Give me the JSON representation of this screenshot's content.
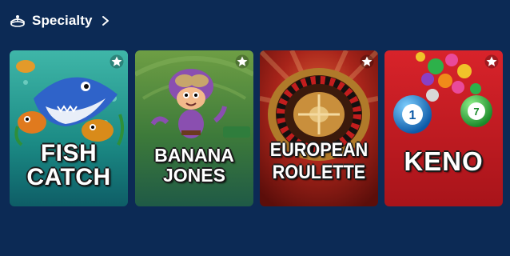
{
  "section": {
    "title": "Specialty",
    "icon": "carousel-icon",
    "link_icon": "chevron-right-icon"
  },
  "games": [
    {
      "line1": "FISH",
      "line2": "CATCH",
      "favorite_icon": "star-icon"
    },
    {
      "line1": "BANANA",
      "line2": "JONES",
      "favorite_icon": "star-icon"
    },
    {
      "line1": "EUROPEAN",
      "line2": "ROULETTE",
      "favorite_icon": "star-icon"
    },
    {
      "line1": "KENO",
      "line2": "",
      "favorite_icon": "star-icon"
    }
  ],
  "colors": {
    "page_background": "#0c2a55",
    "text": "#ffffff",
    "fish_bg": "#1d8a86",
    "banana_bg": "#4c8a3e",
    "roulette_bg": "#8e1a12",
    "keno_bg": "#c41a1e"
  }
}
